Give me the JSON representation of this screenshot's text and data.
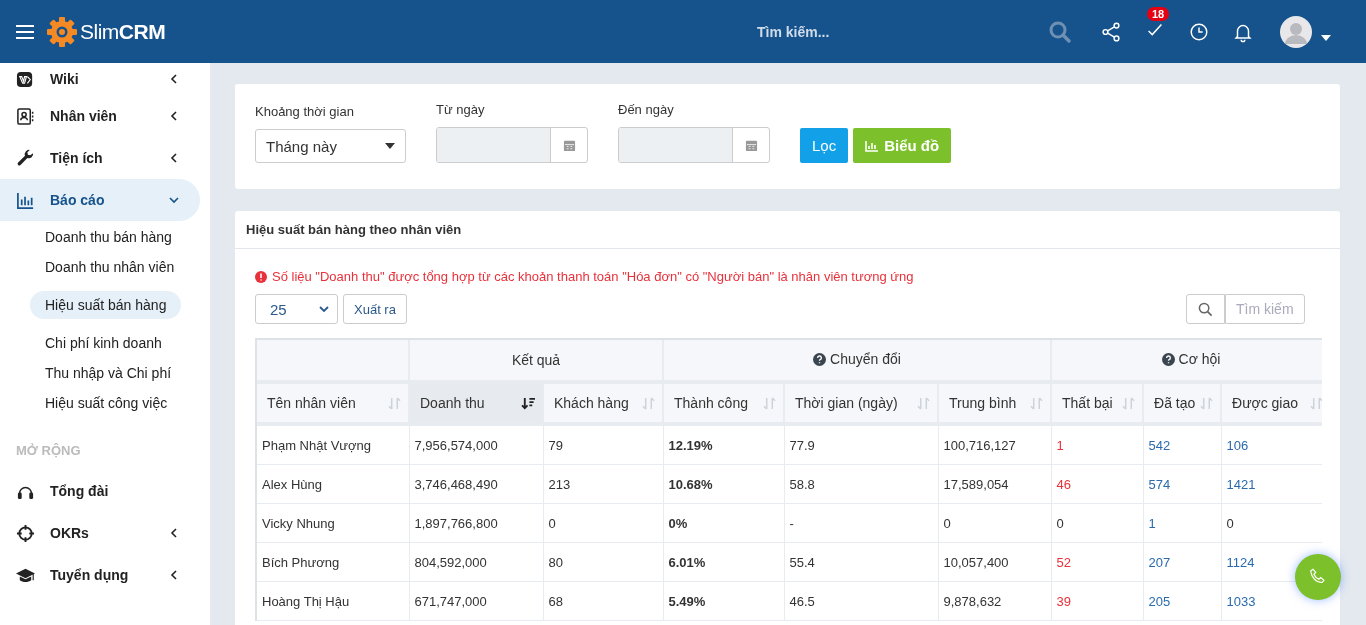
{
  "header": {
    "brand_light": "Slim",
    "brand_bold": "CRM",
    "search": {
      "placeholder": "Tìm kiếm..."
    },
    "badge": "18"
  },
  "sidebar": {
    "groups": [
      {
        "items": [
          {
            "label": "Wiki",
            "expanded": false,
            "selected": false
          },
          {
            "label": "Nhân viên",
            "expanded": false,
            "selected": false
          },
          {
            "label": "Tiện ích",
            "expanded": false,
            "selected": false
          },
          {
            "label": "Báo cáo",
            "expanded": true,
            "selected": true,
            "children": [
              {
                "label": "Doanh thu bán hàng",
                "selected": false
              },
              {
                "label": "Doanh thu nhân viên",
                "selected": false
              },
              {
                "label": "Hiệu suất bán hàng",
                "selected": true
              },
              {
                "label": "Chi phí kinh doanh",
                "selected": false
              },
              {
                "label": "Thu nhập và Chi phí",
                "selected": false
              },
              {
                "label": "Hiệu suất công việc",
                "selected": false
              }
            ]
          }
        ]
      },
      {
        "heading": "MỞ RỘNG",
        "items": [
          {
            "label": "Tổng đài",
            "selected": false
          },
          {
            "label": "OKRs",
            "expanded": false,
            "selected": false
          },
          {
            "label": "Tuyển dụng",
            "expanded": false,
            "selected": false
          }
        ]
      }
    ]
  },
  "filters": {
    "period": {
      "label": "Khoảng thời gian",
      "value": "Tháng này"
    },
    "from": {
      "label": "Từ ngày"
    },
    "to": {
      "label": "Đến ngày"
    },
    "filter_button": "Lọc",
    "chart_button": "Biểu đồ"
  },
  "report": {
    "title": "Hiệu suất bán hàng theo nhân viên",
    "notice": "Số liệu \"Doanh thu\" được tổng hợp từ các khoản thanh toán \"Hóa đơn\" có \"Người bán\" là nhân viên tương ứng",
    "page_size": "25",
    "export_button": "Xuất ra",
    "search": {
      "placeholder": "Tìm kiếm"
    },
    "groups": [
      {
        "help": false
      },
      {
        "label": "Kết quả",
        "help": false
      },
      {
        "label": "Chuyển đổi",
        "help": true
      },
      {
        "label": "Cơ hội",
        "help": true
      }
    ],
    "columns": [
      {
        "label": "Tên nhân viên",
        "sorted": false
      },
      {
        "label": "Doanh thu",
        "sorted": true
      },
      {
        "label": "Khách hàng",
        "sorted": false
      },
      {
        "label": "Thành công",
        "sorted": false
      },
      {
        "label": "Thời gian (ngày)",
        "sorted": false
      },
      {
        "label": "Trung bình",
        "sorted": false
      },
      {
        "label": "Thất bại",
        "sorted": false
      },
      {
        "label": "Đã tạo",
        "sorted": false
      },
      {
        "label": "Được giao",
        "sorted": false
      }
    ],
    "rows": [
      {
        "cells": [
          {
            "text": "Phạm Nhật Vượng"
          },
          {
            "text": "7,956,574,000"
          },
          {
            "text": "79"
          },
          {
            "text": "12.19%"
          },
          {
            "text": "77.9"
          },
          {
            "text": "100,716,127"
          },
          {
            "text": "1",
            "color": "#e8313b"
          },
          {
            "text": "542",
            "color": "#2a6aad"
          },
          {
            "text": "106",
            "color": "#2a6aad"
          }
        ]
      },
      {
        "cells": [
          {
            "text": "Alex Hùng"
          },
          {
            "text": "3,746,468,490"
          },
          {
            "text": "213"
          },
          {
            "text": "10.68%"
          },
          {
            "text": "58.8"
          },
          {
            "text": "17,589,054"
          },
          {
            "text": "46",
            "color": "#e8313b"
          },
          {
            "text": "574",
            "color": "#2a6aad"
          },
          {
            "text": "1421",
            "color": "#2a6aad"
          }
        ]
      },
      {
        "cells": [
          {
            "text": "Vicky Nhung"
          },
          {
            "text": "1,897,766,800"
          },
          {
            "text": "0"
          },
          {
            "text": "0%"
          },
          {
            "text": "-"
          },
          {
            "text": "0"
          },
          {
            "text": "0"
          },
          {
            "text": "1",
            "color": "#2a6aad"
          },
          {
            "text": "0"
          }
        ]
      },
      {
        "cells": [
          {
            "text": "Bích Phương"
          },
          {
            "text": "804,592,000"
          },
          {
            "text": "80"
          },
          {
            "text": "6.01%"
          },
          {
            "text": "55.4"
          },
          {
            "text": "10,057,400"
          },
          {
            "text": "52",
            "color": "#e8313b"
          },
          {
            "text": "207",
            "color": "#2a6aad"
          },
          {
            "text": "1124",
            "color": "#2a6aad"
          }
        ]
      },
      {
        "cells": [
          {
            "text": "Hoàng Thị Hậu"
          },
          {
            "text": "671,747,000"
          },
          {
            "text": "68"
          },
          {
            "text": "5.49%"
          },
          {
            "text": "46.5"
          },
          {
            "text": "9,878,632"
          },
          {
            "text": "39",
            "color": "#e8313b"
          },
          {
            "text": "205",
            "color": "#2a6aad"
          },
          {
            "text": "1033",
            "color": "#2a6aad"
          }
        ]
      }
    ]
  }
}
